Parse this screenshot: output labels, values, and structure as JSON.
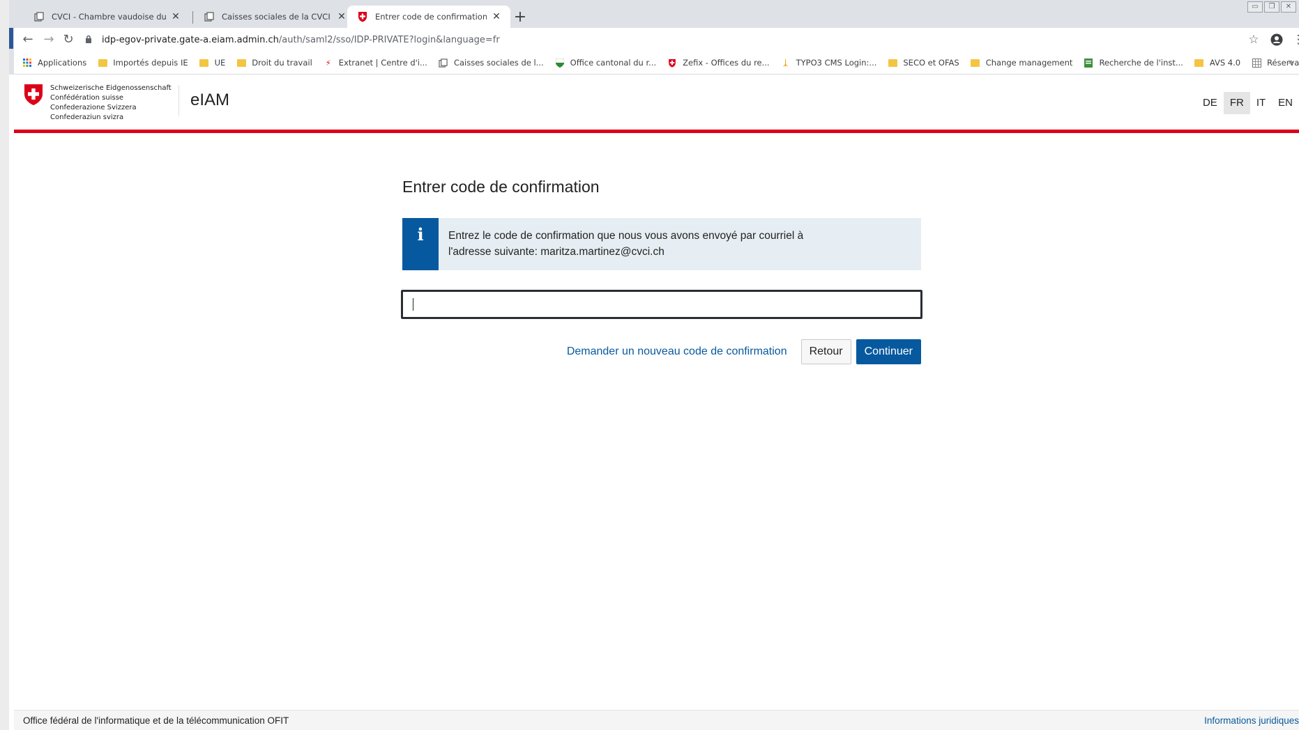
{
  "browser": {
    "tabs": [
      {
        "title": "CVCI - Chambre vaudoise du commerce",
        "icon": "page-icon",
        "active": false
      },
      {
        "title": "Caisses sociales de la CVCI - eServices",
        "icon": "page-icon",
        "active": false
      },
      {
        "title": "Entrer code de confirmation",
        "icon": "swiss-shield-icon",
        "active": true
      }
    ],
    "url_host": "idp-egov-private.gate-a.eiam.admin.ch",
    "url_path": "/auth/saml2/sso/IDP-PRIVATE?login&language=fr",
    "bookmarks": [
      {
        "label": "Applications",
        "icon": "apps-grid-icon"
      },
      {
        "label": "Importés depuis IE",
        "icon": "folder-icon"
      },
      {
        "label": "UE",
        "icon": "folder-icon"
      },
      {
        "label": "Droit du travail",
        "icon": "folder-icon"
      },
      {
        "label": "Extranet | Centre d'i...",
        "icon": "extranet-icon"
      },
      {
        "label": "Caisses sociales de l...",
        "icon": "page-icon"
      },
      {
        "label": "Office cantonal du r...",
        "icon": "vaud-shield-icon"
      },
      {
        "label": "Zefix - Offices du re...",
        "icon": "swiss-shield-icon"
      },
      {
        "label": "TYPO3 CMS Login:...",
        "icon": "typo3-icon"
      },
      {
        "label": "SECO et OFAS",
        "icon": "folder-icon"
      },
      {
        "label": "Change management",
        "icon": "folder-icon"
      },
      {
        "label": "Recherche de l'inst...",
        "icon": "green-page-icon"
      },
      {
        "label": "AVS 4.0",
        "icon": "folder-icon"
      },
      {
        "label": "Réservation de salles",
        "icon": "grid-page-icon"
      }
    ],
    "bookmarks_overflow": "»"
  },
  "header": {
    "confederation_names": [
      "Schweizerische Eidgenossenschaft",
      "Confédération suisse",
      "Confederazione Svizzera",
      "Confederaziun svizra"
    ],
    "app_name": "eIAM",
    "languages": [
      {
        "code": "DE",
        "active": false
      },
      {
        "code": "FR",
        "active": true
      },
      {
        "code": "IT",
        "active": false
      },
      {
        "code": "EN",
        "active": false
      }
    ]
  },
  "main": {
    "title": "Entrer code de confirmation",
    "info_icon": "i",
    "info_message": "Entrez le code de confirmation que nous vous avons envoyé par courriel à l'adresse suivante: maritza.martinez@cvci.ch",
    "code_input_value": "",
    "request_new_code_link": "Demander un nouveau code de confirmation",
    "back_button": "Retour",
    "continue_button": "Continuer"
  },
  "footer": {
    "left": "Office fédéral de l'informatique et de la télécommunication OFIT",
    "right": "Informations juridiques"
  },
  "colors": {
    "swiss_red": "#dc0018",
    "primary_blue": "#06599e",
    "info_bg": "#e6eef3"
  }
}
